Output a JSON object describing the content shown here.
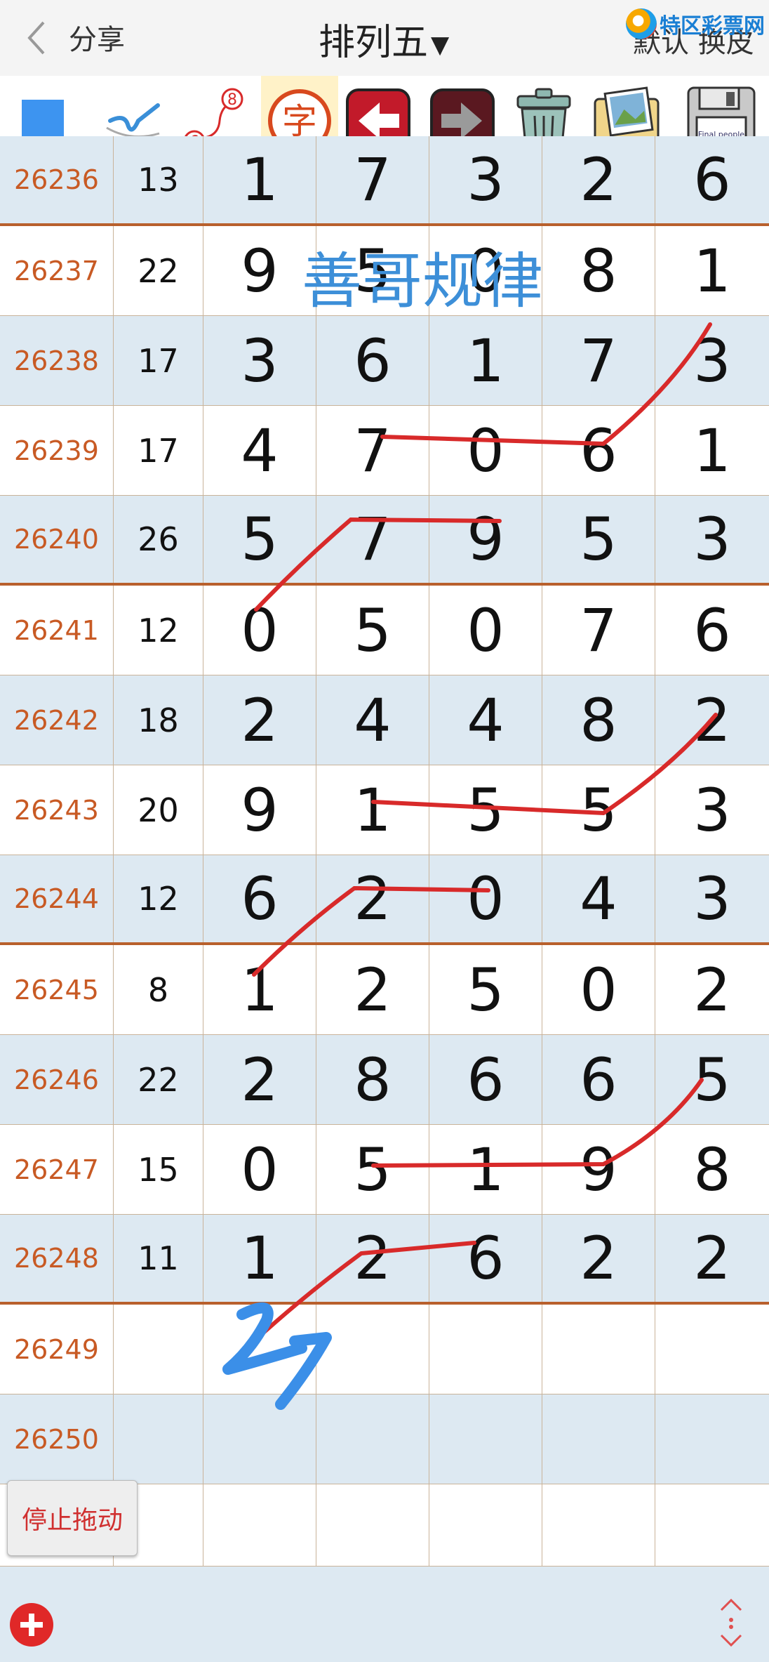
{
  "header": {
    "back_label": "分享",
    "title": "排列五",
    "title_caret": "▼",
    "skin_label": "默认 换皮",
    "logo_text": "特区彩票网"
  },
  "toolbar": {
    "icons": [
      "square-icon",
      "pen-check-icon",
      "link-6-8-icon",
      "char-icon",
      "left-arrow-icon",
      "right-arrow-icon",
      "trash-icon",
      "photo-icon",
      "save-icon"
    ],
    "link_numbers": [
      "6",
      "8"
    ],
    "char_label": "字",
    "save_label": "Final people"
  },
  "watermark": "善哥规律",
  "annotation": "27",
  "rows": [
    {
      "id": "26236",
      "sum": "13",
      "d": [
        "1",
        "7",
        "3",
        "2",
        "6"
      ]
    },
    {
      "id": "26237",
      "sum": "22",
      "d": [
        "9",
        "5",
        "0",
        "8",
        "1"
      ]
    },
    {
      "id": "26238",
      "sum": "17",
      "d": [
        "3",
        "6",
        "1",
        "7",
        "3"
      ]
    },
    {
      "id": "26239",
      "sum": "17",
      "d": [
        "4",
        "7",
        "0",
        "6",
        "1"
      ]
    },
    {
      "id": "26240",
      "sum": "26",
      "d": [
        "5",
        "7",
        "9",
        "5",
        "3"
      ]
    },
    {
      "id": "26241",
      "sum": "12",
      "d": [
        "0",
        "5",
        "0",
        "7",
        "6"
      ]
    },
    {
      "id": "26242",
      "sum": "18",
      "d": [
        "2",
        "4",
        "4",
        "8",
        "2"
      ]
    },
    {
      "id": "26243",
      "sum": "20",
      "d": [
        "9",
        "1",
        "5",
        "5",
        "3"
      ]
    },
    {
      "id": "26244",
      "sum": "12",
      "d": [
        "6",
        "2",
        "0",
        "4",
        "3"
      ]
    },
    {
      "id": "26245",
      "sum": "8",
      "d": [
        "1",
        "2",
        "5",
        "0",
        "2"
      ]
    },
    {
      "id": "26246",
      "sum": "22",
      "d": [
        "2",
        "8",
        "6",
        "6",
        "5"
      ]
    },
    {
      "id": "26247",
      "sum": "15",
      "d": [
        "0",
        "5",
        "1",
        "9",
        "8"
      ]
    },
    {
      "id": "26248",
      "sum": "11",
      "d": [
        "1",
        "2",
        "6",
        "2",
        "2"
      ]
    },
    {
      "id": "26249",
      "sum": "",
      "d": [
        "",
        "",
        "",
        "",
        ""
      ]
    },
    {
      "id": "26250",
      "sum": "",
      "d": [
        "",
        "",
        "",
        "",
        ""
      ]
    },
    {
      "id": "",
      "sum": "",
      "d": [
        "",
        "",
        "",
        "",
        ""
      ]
    }
  ],
  "stop_drag_label": "停止拖动",
  "colors": {
    "accent_red": "#d82a2a",
    "row_alt": "#dde9f2",
    "id_color": "#c85a24",
    "ink_blue": "#3b8fe8"
  }
}
